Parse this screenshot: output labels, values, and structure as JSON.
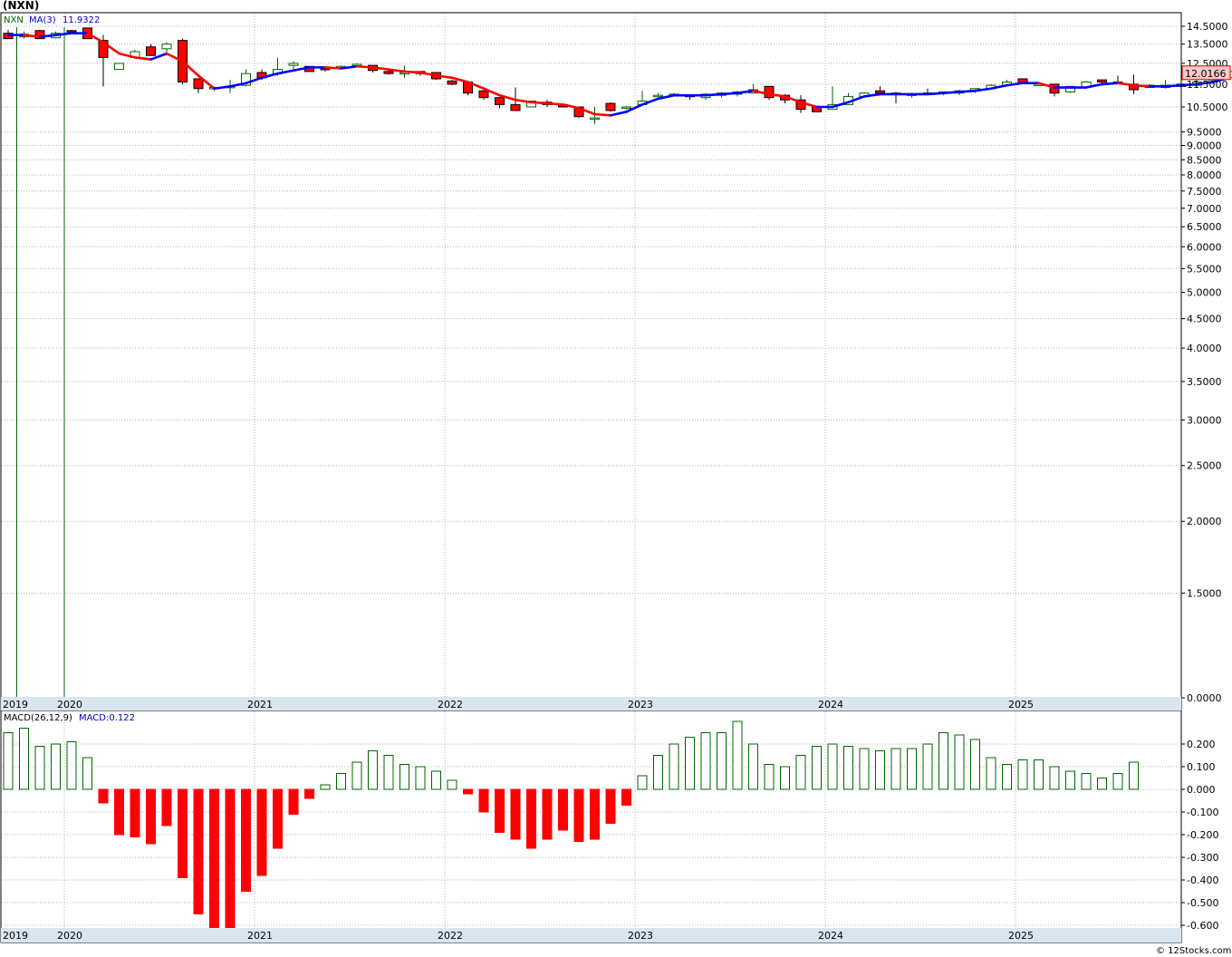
{
  "title": "(NXN)",
  "watermark": "© 12Stocks.com",
  "colors": {
    "up": "#006400",
    "down": "#ff0000",
    "ma": "#0000ff",
    "ma_down": "#ff0000",
    "last_price_bg": "#ffc8c8"
  },
  "chart_data": [
    {
      "type": "candlestick",
      "symbol_label": "NXN",
      "ma_label": "MA(3)",
      "ma_value": "11.9322",
      "last_price": "12.0166",
      "y_scale": "log",
      "grid": true,
      "y_ticks": [
        "14.5000",
        "13.5000",
        "12.5000",
        "11.5000",
        "10.5000",
        "9.5000",
        "9.0000",
        "8.5000",
        "8.0000",
        "7.5000",
        "7.0000",
        "6.5000",
        "6.0000",
        "5.5000",
        "5.0000",
        "4.5000",
        "4.0000",
        "3.5000",
        "3.0000",
        "2.5000",
        "2.0000",
        "1.5000",
        "0.0000"
      ],
      "x_labels": [
        "2019",
        "2020",
        "2021",
        "2022",
        "2023",
        "2024",
        "2025"
      ],
      "x_label_index": [
        0,
        4,
        16,
        28,
        40,
        52,
        64
      ],
      "event_lines_index": [
        1,
        4
      ],
      "ohlc": [
        [
          14.1,
          14.3,
          13.8,
          13.8
        ],
        [
          13.9,
          14.2,
          13.8,
          14.05
        ],
        [
          14.25,
          14.3,
          13.8,
          13.8
        ],
        [
          13.85,
          14.2,
          13.8,
          14.1
        ],
        [
          14.25,
          14.3,
          14.1,
          14.2
        ],
        [
          14.4,
          14.4,
          13.8,
          13.8
        ],
        [
          13.7,
          14.0,
          11.4,
          12.8
        ],
        [
          12.2,
          12.5,
          12.2,
          12.5
        ],
        [
          12.8,
          13.2,
          12.8,
          13.1
        ],
        [
          13.35,
          13.5,
          12.9,
          12.9
        ],
        [
          13.25,
          13.6,
          12.9,
          13.5
        ],
        [
          13.7,
          13.8,
          11.5,
          11.6
        ],
        [
          11.75,
          11.75,
          11.1,
          11.3
        ],
        [
          11.35,
          11.4,
          11.2,
          11.35
        ],
        [
          11.4,
          11.7,
          11.1,
          11.4
        ],
        [
          11.45,
          12.2,
          11.4,
          12.0
        ],
        [
          12.05,
          12.2,
          11.7,
          11.8
        ],
        [
          12.0,
          12.8,
          11.9,
          12.2
        ],
        [
          12.4,
          12.6,
          12.2,
          12.5
        ],
        [
          12.35,
          12.35,
          12.1,
          12.1
        ],
        [
          12.25,
          12.3,
          12.1,
          12.2
        ],
        [
          12.3,
          12.4,
          12.2,
          12.35
        ],
        [
          12.45,
          12.5,
          12.3,
          12.45
        ],
        [
          12.4,
          12.4,
          12.05,
          12.15
        ],
        [
          12.1,
          12.2,
          11.95,
          12.0
        ],
        [
          12.0,
          12.4,
          11.8,
          12.05
        ],
        [
          12.1,
          12.1,
          11.9,
          12.0
        ],
        [
          12.05,
          12.05,
          11.7,
          11.75
        ],
        [
          11.65,
          11.7,
          11.45,
          11.5
        ],
        [
          11.6,
          11.6,
          11.0,
          11.1
        ],
        [
          11.2,
          11.2,
          10.8,
          10.9
        ],
        [
          10.9,
          10.9,
          10.45,
          10.6
        ],
        [
          10.6,
          11.35,
          10.35,
          10.35
        ],
        [
          10.5,
          10.75,
          10.5,
          10.75
        ],
        [
          10.7,
          10.8,
          10.5,
          10.6
        ],
        [
          10.6,
          10.6,
          10.5,
          10.5
        ],
        [
          10.5,
          10.5,
          10.05,
          10.1
        ],
        [
          10.05,
          10.5,
          9.8,
          10.05
        ],
        [
          10.65,
          10.7,
          10.3,
          10.35
        ],
        [
          10.45,
          10.55,
          10.4,
          10.5
        ],
        [
          10.6,
          11.2,
          10.6,
          10.75
        ],
        [
          11.0,
          11.1,
          10.95,
          11.0
        ],
        [
          11.05,
          11.1,
          11.0,
          11.05
        ],
        [
          11.0,
          11.05,
          10.8,
          10.95
        ],
        [
          10.9,
          11.1,
          10.8,
          11.05
        ],
        [
          11.0,
          11.15,
          10.9,
          11.1
        ],
        [
          11.05,
          11.2,
          10.95,
          11.15
        ],
        [
          11.1,
          11.5,
          11.1,
          11.25
        ],
        [
          11.4,
          11.4,
          10.8,
          10.9
        ],
        [
          11.0,
          11.05,
          10.65,
          10.8
        ],
        [
          10.8,
          11.0,
          10.25,
          10.4
        ],
        [
          10.5,
          10.5,
          10.3,
          10.3
        ],
        [
          10.4,
          11.4,
          10.4,
          10.6
        ],
        [
          10.6,
          11.1,
          10.6,
          10.95
        ],
        [
          10.95,
          11.15,
          10.95,
          11.1
        ],
        [
          11.2,
          11.4,
          11.0,
          11.1
        ],
        [
          11.1,
          11.15,
          10.65,
          11.05
        ],
        [
          11.0,
          11.1,
          10.9,
          11.05
        ],
        [
          11.1,
          11.3,
          11.0,
          11.05
        ],
        [
          11.1,
          11.15,
          11.0,
          11.15
        ],
        [
          11.1,
          11.25,
          11.0,
          11.2
        ],
        [
          11.2,
          11.3,
          11.1,
          11.3
        ],
        [
          11.3,
          11.5,
          11.25,
          11.45
        ],
        [
          11.45,
          11.7,
          11.45,
          11.6
        ],
        [
          11.75,
          11.75,
          11.55,
          11.55
        ],
        [
          11.5,
          11.5,
          11.5,
          11.5
        ],
        [
          11.5,
          11.5,
          10.95,
          11.1
        ],
        [
          11.15,
          11.4,
          11.1,
          11.4
        ],
        [
          11.35,
          11.65,
          11.35,
          11.6
        ],
        [
          11.7,
          11.7,
          11.55,
          11.6
        ],
        [
          11.6,
          11.9,
          11.5,
          11.55
        ],
        [
          11.5,
          11.95,
          11.05,
          11.25
        ],
        [
          11.35,
          11.5,
          11.35,
          11.45
        ],
        [
          11.35,
          11.7,
          11.3,
          11.45
        ],
        [
          11.5,
          11.7,
          11.35,
          11.4
        ],
        [
          11.45,
          11.75,
          11.45,
          11.6
        ],
        [
          11.6,
          11.9,
          11.5,
          11.7
        ],
        [
          11.8,
          12.3,
          11.8,
          12.1
        ]
      ],
      "ma": [
        14.0,
        14.0,
        13.9,
        14.0,
        14.1,
        14.1,
        13.6,
        13.0,
        12.8,
        12.7,
        13.0,
        12.6,
        11.9,
        11.3,
        11.4,
        11.55,
        11.8,
        12.0,
        12.15,
        12.3,
        12.3,
        12.25,
        12.35,
        12.3,
        12.2,
        12.1,
        12.05,
        11.9,
        11.8,
        11.6,
        11.3,
        11.0,
        10.8,
        10.7,
        10.65,
        10.6,
        10.45,
        10.2,
        10.15,
        10.3,
        10.6,
        10.85,
        11.0,
        11.0,
        11.0,
        11.05,
        11.1,
        11.2,
        11.05,
        10.95,
        10.7,
        10.5,
        10.5,
        10.7,
        10.95,
        11.05,
        11.05,
        11.05,
        11.05,
        11.1,
        11.15,
        11.2,
        11.3,
        11.45,
        11.55,
        11.55,
        11.35,
        11.35,
        11.35,
        11.5,
        11.55,
        11.45,
        11.4,
        11.4,
        11.45,
        11.5,
        11.6,
        11.8
      ]
    },
    {
      "type": "bar",
      "macd_label": "MACD(26,12,9)",
      "macd_value_label": "MACD:0.122",
      "grid": true,
      "y_ticks": [
        "0.200",
        "0.100",
        "0.000",
        "-0.100",
        "-0.200",
        "-0.300",
        "-0.400",
        "-0.500",
        "-0.600"
      ],
      "ylim": [
        -0.6,
        0.3
      ],
      "values": [
        0.25,
        0.27,
        0.19,
        0.2,
        0.21,
        0.14,
        -0.06,
        -0.2,
        -0.21,
        -0.24,
        -0.16,
        -0.39,
        -0.55,
        -0.61,
        -0.61,
        -0.45,
        -0.38,
        -0.26,
        -0.11,
        -0.04,
        0.02,
        0.07,
        0.12,
        0.17,
        0.15,
        0.11,
        0.1,
        0.08,
        0.04,
        -0.02,
        -0.1,
        -0.19,
        -0.22,
        -0.26,
        -0.22,
        -0.18,
        -0.23,
        -0.22,
        -0.15,
        -0.07,
        0.06,
        0.15,
        0.2,
        0.23,
        0.25,
        0.25,
        0.3,
        0.2,
        0.11,
        0.1,
        0.15,
        0.19,
        0.2,
        0.19,
        0.18,
        0.17,
        0.18,
        0.18,
        0.2,
        0.25,
        0.24,
        0.22,
        0.14,
        0.11,
        0.13,
        0.13,
        0.1,
        0.08,
        0.07,
        0.05,
        0.07,
        0.12
      ]
    }
  ]
}
